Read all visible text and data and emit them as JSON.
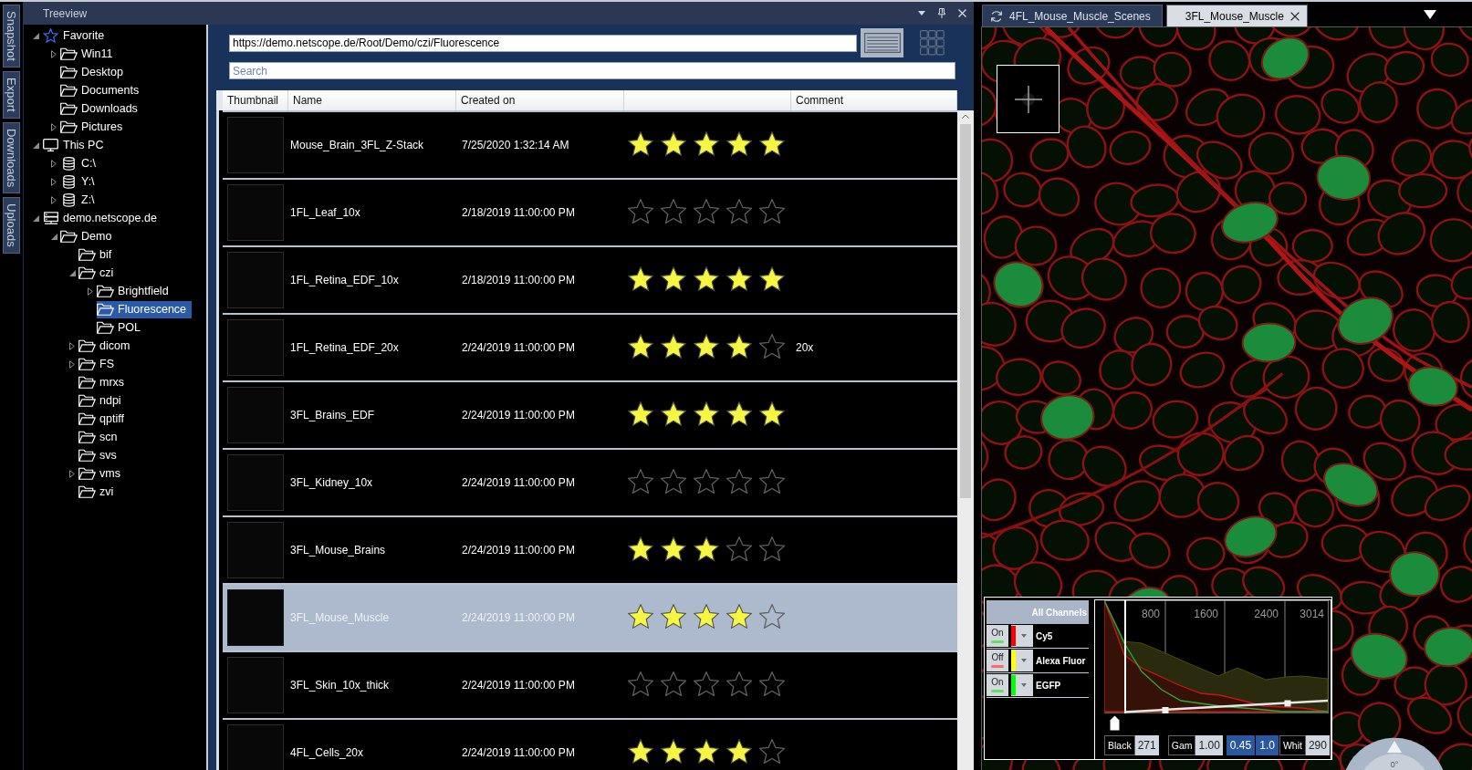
{
  "side_tabs": [
    {
      "label": "Snapshot"
    },
    {
      "label": "Export"
    },
    {
      "label": "Downloads"
    },
    {
      "label": "Uploads"
    }
  ],
  "treeview": {
    "title": "Treeview",
    "items": [
      {
        "kind": "favorites",
        "label": "Favorite",
        "expanded": true,
        "selected": false,
        "children": [
          {
            "kind": "folder",
            "label": "Win11",
            "expanded": false,
            "selected": false
          },
          {
            "kind": "folder",
            "label": "Desktop",
            "selected": false
          },
          {
            "kind": "folder",
            "label": "Documents",
            "selected": false
          },
          {
            "kind": "folder",
            "label": "Downloads",
            "selected": false
          },
          {
            "kind": "folder",
            "label": "Pictures",
            "expanded": false,
            "selected": false
          }
        ]
      },
      {
        "kind": "computer",
        "label": "This PC",
        "expanded": true,
        "selected": false,
        "children": [
          {
            "kind": "drive",
            "label": "C:\\",
            "expanded": false,
            "selected": false
          },
          {
            "kind": "drive",
            "label": "Y:\\",
            "expanded": false,
            "selected": false
          },
          {
            "kind": "drive",
            "label": "Z:\\",
            "expanded": false,
            "selected": false
          }
        ]
      },
      {
        "kind": "server",
        "label": "demo.netscope.de",
        "expanded": true,
        "selected": false,
        "children": [
          {
            "kind": "folder",
            "label": "Demo",
            "expanded": true,
            "selected": false,
            "children": [
              {
                "kind": "folder",
                "label": "bif",
                "selected": false
              },
              {
                "kind": "folder",
                "label": "czi",
                "expanded": true,
                "selected": false,
                "children": [
                  {
                    "kind": "folder",
                    "label": "Brightfield",
                    "expanded": false,
                    "selected": false
                  },
                  {
                    "kind": "folder",
                    "label": "Fluorescence",
                    "selected": true
                  },
                  {
                    "kind": "folder",
                    "label": "POL",
                    "selected": false
                  }
                ]
              },
              {
                "kind": "folder",
                "label": "dicom",
                "expanded": false,
                "selected": false
              },
              {
                "kind": "folder",
                "label": "FS",
                "expanded": false,
                "selected": false
              },
              {
                "kind": "folder",
                "label": "mrxs",
                "selected": false
              },
              {
                "kind": "folder",
                "label": "ndpi",
                "selected": false
              },
              {
                "kind": "folder",
                "label": "qptiff",
                "selected": false
              },
              {
                "kind": "folder",
                "label": "scn",
                "selected": false
              },
              {
                "kind": "folder",
                "label": "svs",
                "selected": false
              },
              {
                "kind": "folder",
                "label": "vms",
                "expanded": false,
                "selected": false
              },
              {
                "kind": "folder",
                "label": "zvi",
                "selected": false
              }
            ]
          }
        ]
      }
    ]
  },
  "browser": {
    "url": "https://demo.netscope.de/Root/Demo/czi/Fluorescence",
    "view_modes": [
      {
        "kind": "list",
        "selected": true
      },
      {
        "kind": "grid",
        "selected": false
      }
    ],
    "search": {
      "placeholder": "Search"
    },
    "columns": [
      {
        "kind": "thumbnail",
        "label": "Thumbnail"
      },
      {
        "kind": "name",
        "label": "Name"
      },
      {
        "kind": "created",
        "label": "Created on"
      },
      {
        "kind": "rating"
      },
      {
        "kind": "comment",
        "label": "Comment"
      }
    ],
    "rows": [
      {
        "name": "Mouse_Brain_3FL_Z-Stack",
        "created": "7/25/2020 1:32:14 AM",
        "stars": 5,
        "selected": false
      },
      {
        "name": "1FL_Leaf_10x",
        "created": "2/18/2019 11:00:00 PM",
        "stars": 0,
        "selected": false
      },
      {
        "name": "1FL_Retina_EDF_10x",
        "created": "2/18/2019 11:00:00 PM",
        "stars": 5,
        "selected": false
      },
      {
        "name": "1FL_Retina_EDF_20x",
        "created": "2/24/2019 11:00:00 PM",
        "stars": 4,
        "comment": "20x",
        "selected": false
      },
      {
        "name": "3FL_Brains_EDF",
        "created": "2/24/2019 11:00:00 PM",
        "stars": 5,
        "selected": false
      },
      {
        "name": "3FL_Kidney_10x",
        "created": "2/24/2019 11:00:00 PM",
        "stars": 0,
        "selected": false
      },
      {
        "name": "3FL_Mouse_Brains",
        "created": "2/24/2019 11:00:00 PM",
        "stars": 3,
        "selected": false
      },
      {
        "name": "3FL_Mouse_Muscle",
        "created": "2/24/2019 11:00:00 PM",
        "stars": 4,
        "selected": true
      },
      {
        "name": "3FL_Skin_10x_thick",
        "created": "2/24/2019 11:00:00 PM",
        "stars": 0,
        "selected": false
      },
      {
        "name": "4FL_Cells_20x",
        "created": "2/24/2019 11:00:00 PM",
        "stars": 4,
        "selected": false
      }
    ]
  },
  "viewer": {
    "tabs": [
      {
        "label": "4FL_Mouse_Muscle_Scenes",
        "selected": false
      },
      {
        "label": "3FL_Mouse_Muscle",
        "selected": true
      }
    ],
    "channels": {
      "header": "All Channels",
      "items": [
        {
          "toggle": "On",
          "on": true,
          "color": "#ff0000",
          "name": "Cy5"
        },
        {
          "toggle": "Off",
          "on": false,
          "color": "#ffff00",
          "name": "Alexa Fluor"
        },
        {
          "toggle": "On",
          "on": true,
          "color": "#00ff00",
          "name": "EGFP"
        }
      ]
    },
    "histogram": {
      "tick_labels": [
        "800",
        "1600",
        "2400",
        "3014"
      ]
    },
    "display": {
      "black": {
        "label": "Black",
        "value": "271"
      },
      "gamma": {
        "label": "Gam",
        "value": "1.00"
      },
      "presets": [
        "0.45",
        "1.0"
      ],
      "white": {
        "label": "Whit",
        "value": "290"
      }
    },
    "rotation": {
      "label": "0°"
    }
  }
}
